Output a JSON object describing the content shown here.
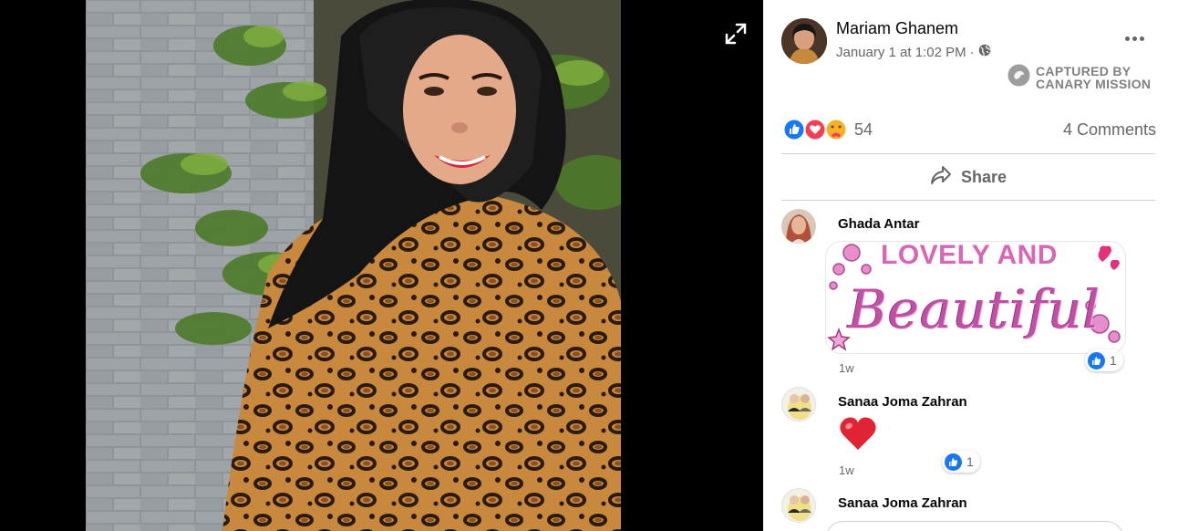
{
  "post": {
    "author": "Mariam Ghanem",
    "timestamp": "January 1 at 1:02 PM",
    "meta_separator": "·",
    "privacy_icon": "globe-icon",
    "reactions": [
      "like",
      "love",
      "care"
    ],
    "reaction_count": "54",
    "comments_count": "4 Comments",
    "share_label": "Share"
  },
  "watermark": {
    "line1": "CAPTURED BY",
    "line2": "CANARY MISSION"
  },
  "comments": [
    {
      "author": "Ghada Antar",
      "sticker_line1": "LOVELY AND",
      "sticker_line2": "Beautiful",
      "time": "1w",
      "like_count": "1"
    },
    {
      "author": "Sanaa Joma Zahran",
      "emoji": "❤️",
      "time": "1w",
      "like_count": "1"
    },
    {
      "author": "Sanaa Joma Zahran"
    }
  ],
  "colors": {
    "like_blue": "#1877f2",
    "love_red": "#f33e58",
    "care_yellow": "#f7b125",
    "text_secondary": "#65676b"
  }
}
